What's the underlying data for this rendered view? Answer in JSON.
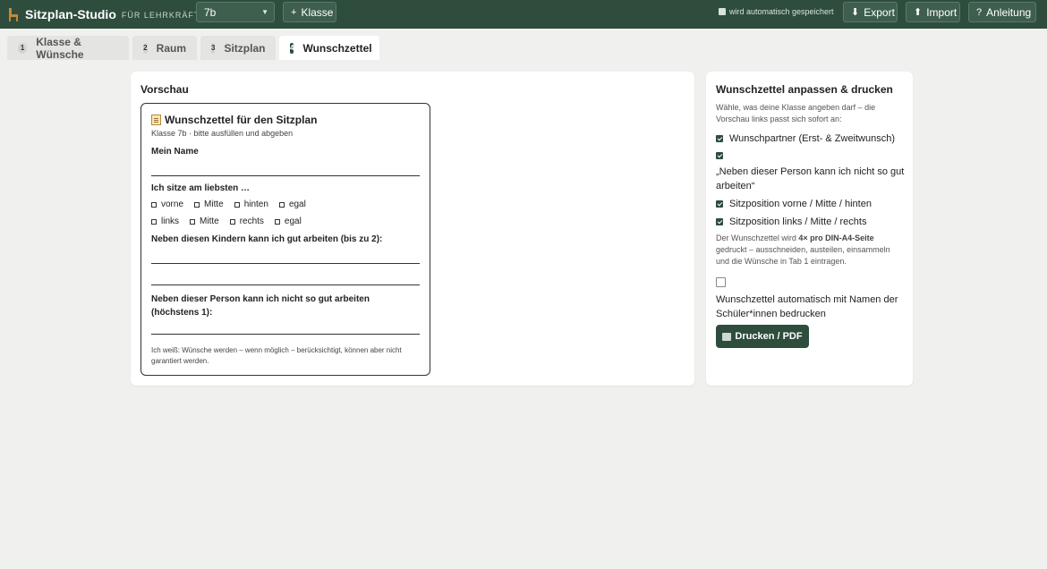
{
  "header": {
    "title": "Sitzplan-Studio",
    "subtitle": "FÜR LEHRKRÄFTE",
    "class_selected": "7b",
    "add_class_label": "Klasse",
    "autosave_text": "wird automatisch gespeichert",
    "export_label": "Export",
    "import_label": "Import",
    "help_label": "Anleitung"
  },
  "tabs": [
    {
      "num": "1",
      "label": "Klasse & Wünsche"
    },
    {
      "num": "2",
      "label": "Raum"
    },
    {
      "num": "3",
      "label": "Sitzplan"
    },
    {
      "num": "4",
      "label": "Wunschzettel"
    }
  ],
  "preview": {
    "heading": "Vorschau",
    "slip_title": "Wunschzettel für den Sitzplan",
    "slip_subtitle": "Klasse 7b · bitte ausfüllen und abgeben",
    "name_label": "Mein Name",
    "seat_label": "Ich sitze am liebsten …",
    "row1": [
      "vorne",
      "Mitte",
      "hinten",
      "egal"
    ],
    "row2": [
      "links",
      "Mitte",
      "rechts",
      "egal"
    ],
    "partner_label": "Neben diesen Kindern kann ich gut arbeiten (bis zu 2):",
    "avoid_label": "Neben dieser Person kann ich nicht so gut arbeiten (höchstens 1):",
    "footer": "Ich weiß: Wünsche werden – wenn möglich – berücksichtigt, können aber nicht garantiert werden."
  },
  "panel": {
    "heading": "Wunschzettel anpassen & drucken",
    "description": "Wähle, was deine Klasse angeben darf – die Vorschau links passt sich sofort an:",
    "options": [
      {
        "label": "Wunschpartner (Erst- & Zweitwunsch)",
        "checked": true
      },
      {
        "label": "„Neben dieser Person kann ich nicht so gut arbeiten“",
        "checked": true
      },
      {
        "label": "Sitzposition vorne / Mitte / hinten",
        "checked": true
      },
      {
        "label": "Sitzposition links / Mitte / rechts",
        "checked": true
      }
    ],
    "note_prefix": "Der Wunschzettel wird ",
    "note_bold": "4× pro DIN-A4-Seite",
    "note_suffix": " gedruckt – ausschneiden, austeilen, einsammeln und die Wünsche in Tab 1 eintragen.",
    "names_option": {
      "label": "Wunschzettel automatisch mit Namen der Schüler*innen bedrucken",
      "checked": false
    },
    "print_label": "Drucken / PDF"
  }
}
